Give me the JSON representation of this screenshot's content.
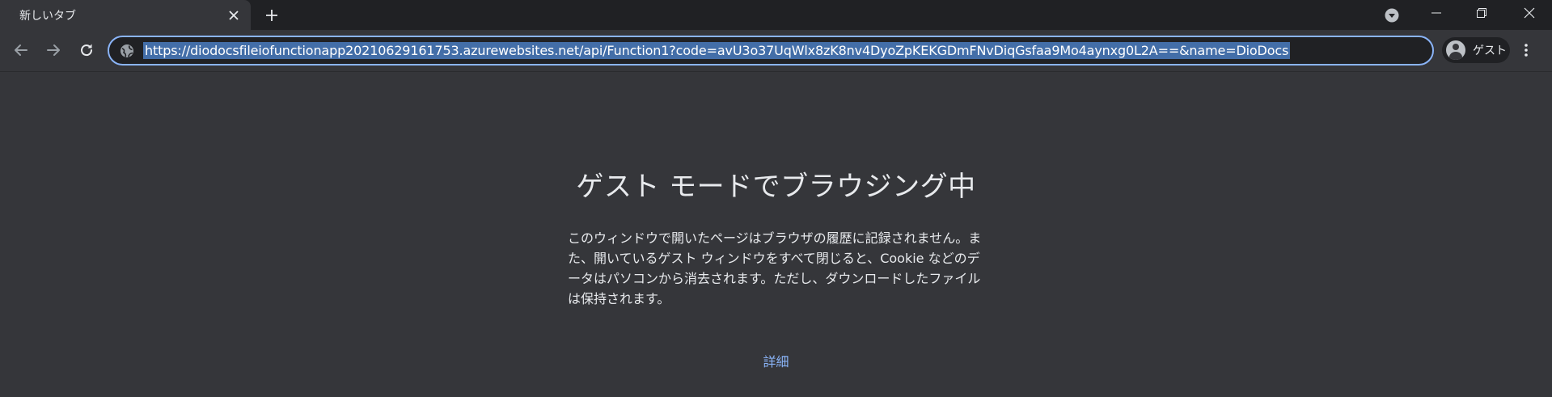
{
  "tab": {
    "title": "新しいタブ"
  },
  "toolbar": {
    "url": "https://diodocsfileiofunctionapp20210629161753.azurewebsites.net/api/Function1?code=avU3o37UqWlx8zK8nv4DyoZpKEKGDmFNvDiqGsfaa9Mo4aynxg0L2A==&name=DioDocs",
    "profile_label": "ゲスト"
  },
  "page": {
    "title": "ゲスト モードでブラウジング中",
    "description": "このウィンドウで開いたページはブラウザの履歴に記録されません。また、開いているゲスト ウィンドウをすべて閉じると、Cookie などのデータはパソコンから消去されます。ただし、ダウンロードしたファイルは保持されます。",
    "learn_more": "詳細"
  },
  "colors": {
    "tabstrip_bg": "#202124",
    "toolbar_bg": "#35363a",
    "accent": "#8ab4f8",
    "url_selection": "#436ea8"
  },
  "icons": {
    "tab_close": "close-icon",
    "new_tab": "plus-icon",
    "tab_search": "chevron-down-circle-icon",
    "back": "arrow-left-icon",
    "forward": "arrow-right-icon",
    "reload": "reload-icon",
    "site_info": "globe-icon",
    "avatar": "person-icon",
    "menu": "kebab-menu-icon",
    "minimize": "minimize-icon",
    "restore": "restore-icon",
    "window_close": "close-icon"
  }
}
